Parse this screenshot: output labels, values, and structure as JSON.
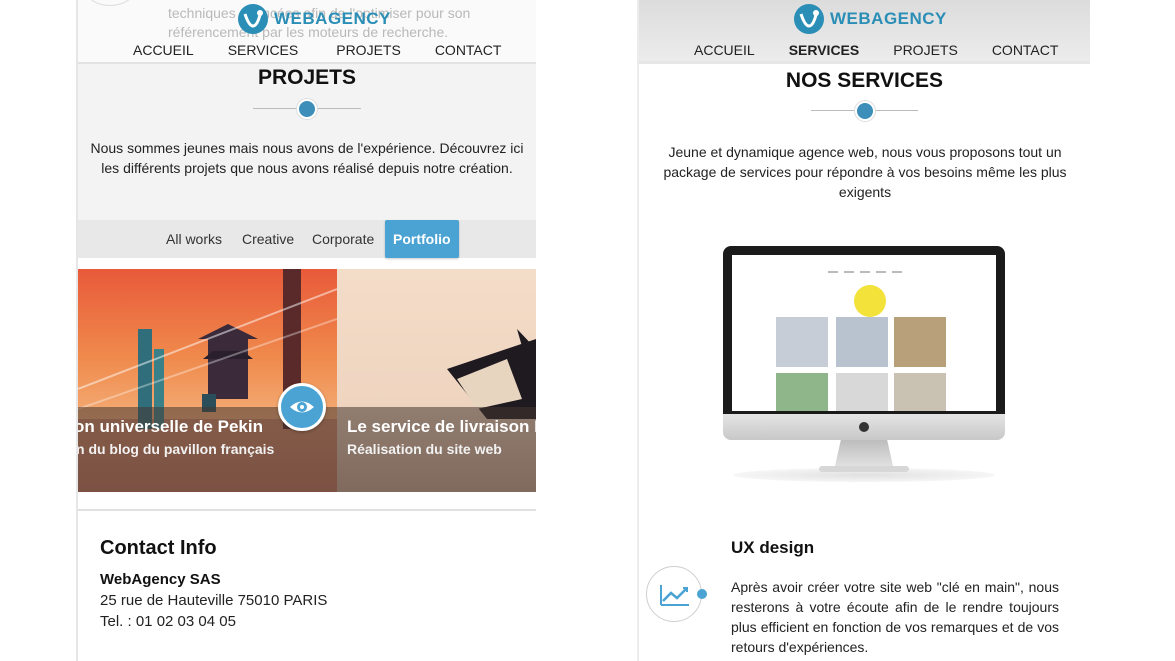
{
  "brand": {
    "name": "WEBAGENCY",
    "color": "#2a8eb6",
    "accent": "#4aa3d3"
  },
  "left": {
    "ghost_text": "techniques avancées afin de l'optimiser pour son référencement par les moteurs de recherche.",
    "nav": [
      "ACCUEIL",
      "SERVICES",
      "PROJETS",
      "CONTACT"
    ],
    "section_title": "PROJETS",
    "description": "Nous sommes jeunes mais nous avons de l'expérience. Découvrez ici les différents projets que nous avons réalisé depuis notre création.",
    "filters": [
      {
        "label": "All works",
        "active": false
      },
      {
        "label": "Creative",
        "active": false
      },
      {
        "label": "Corporate",
        "active": false
      },
      {
        "label": "Portfolio",
        "active": true
      }
    ],
    "projects": [
      {
        "title": "on universelle de Pekin",
        "subtitle": "n du blog du pavillon français"
      },
      {
        "title": "Le service de livraison F",
        "subtitle": "Réalisation du site web"
      }
    ],
    "contact": {
      "title": "Contact Info",
      "company": "WebAgency SAS",
      "address": "25 rue de Hauteville 75010 PARIS",
      "phone": "Tel. : 01 02 03 04 05"
    }
  },
  "right": {
    "nav": [
      "ACCUEIL",
      "SERVICES",
      "PROJETS",
      "CONTACT"
    ],
    "active_nav": "SERVICES",
    "section_title": "NOS SERVICES",
    "description": "Jeune et dynamique agence web, nous vous proposons tout un package de services pour répondre à vos besoins même les plus exigents",
    "service": {
      "title": "UX design",
      "description": "Après avoir créer votre site web \"clé en main\", nous resterons à votre écoute afin de le rendre toujours plus efficient en fonction de vos remarques et de vos retours d'expériences.",
      "icon": "chart-line-icon"
    }
  }
}
